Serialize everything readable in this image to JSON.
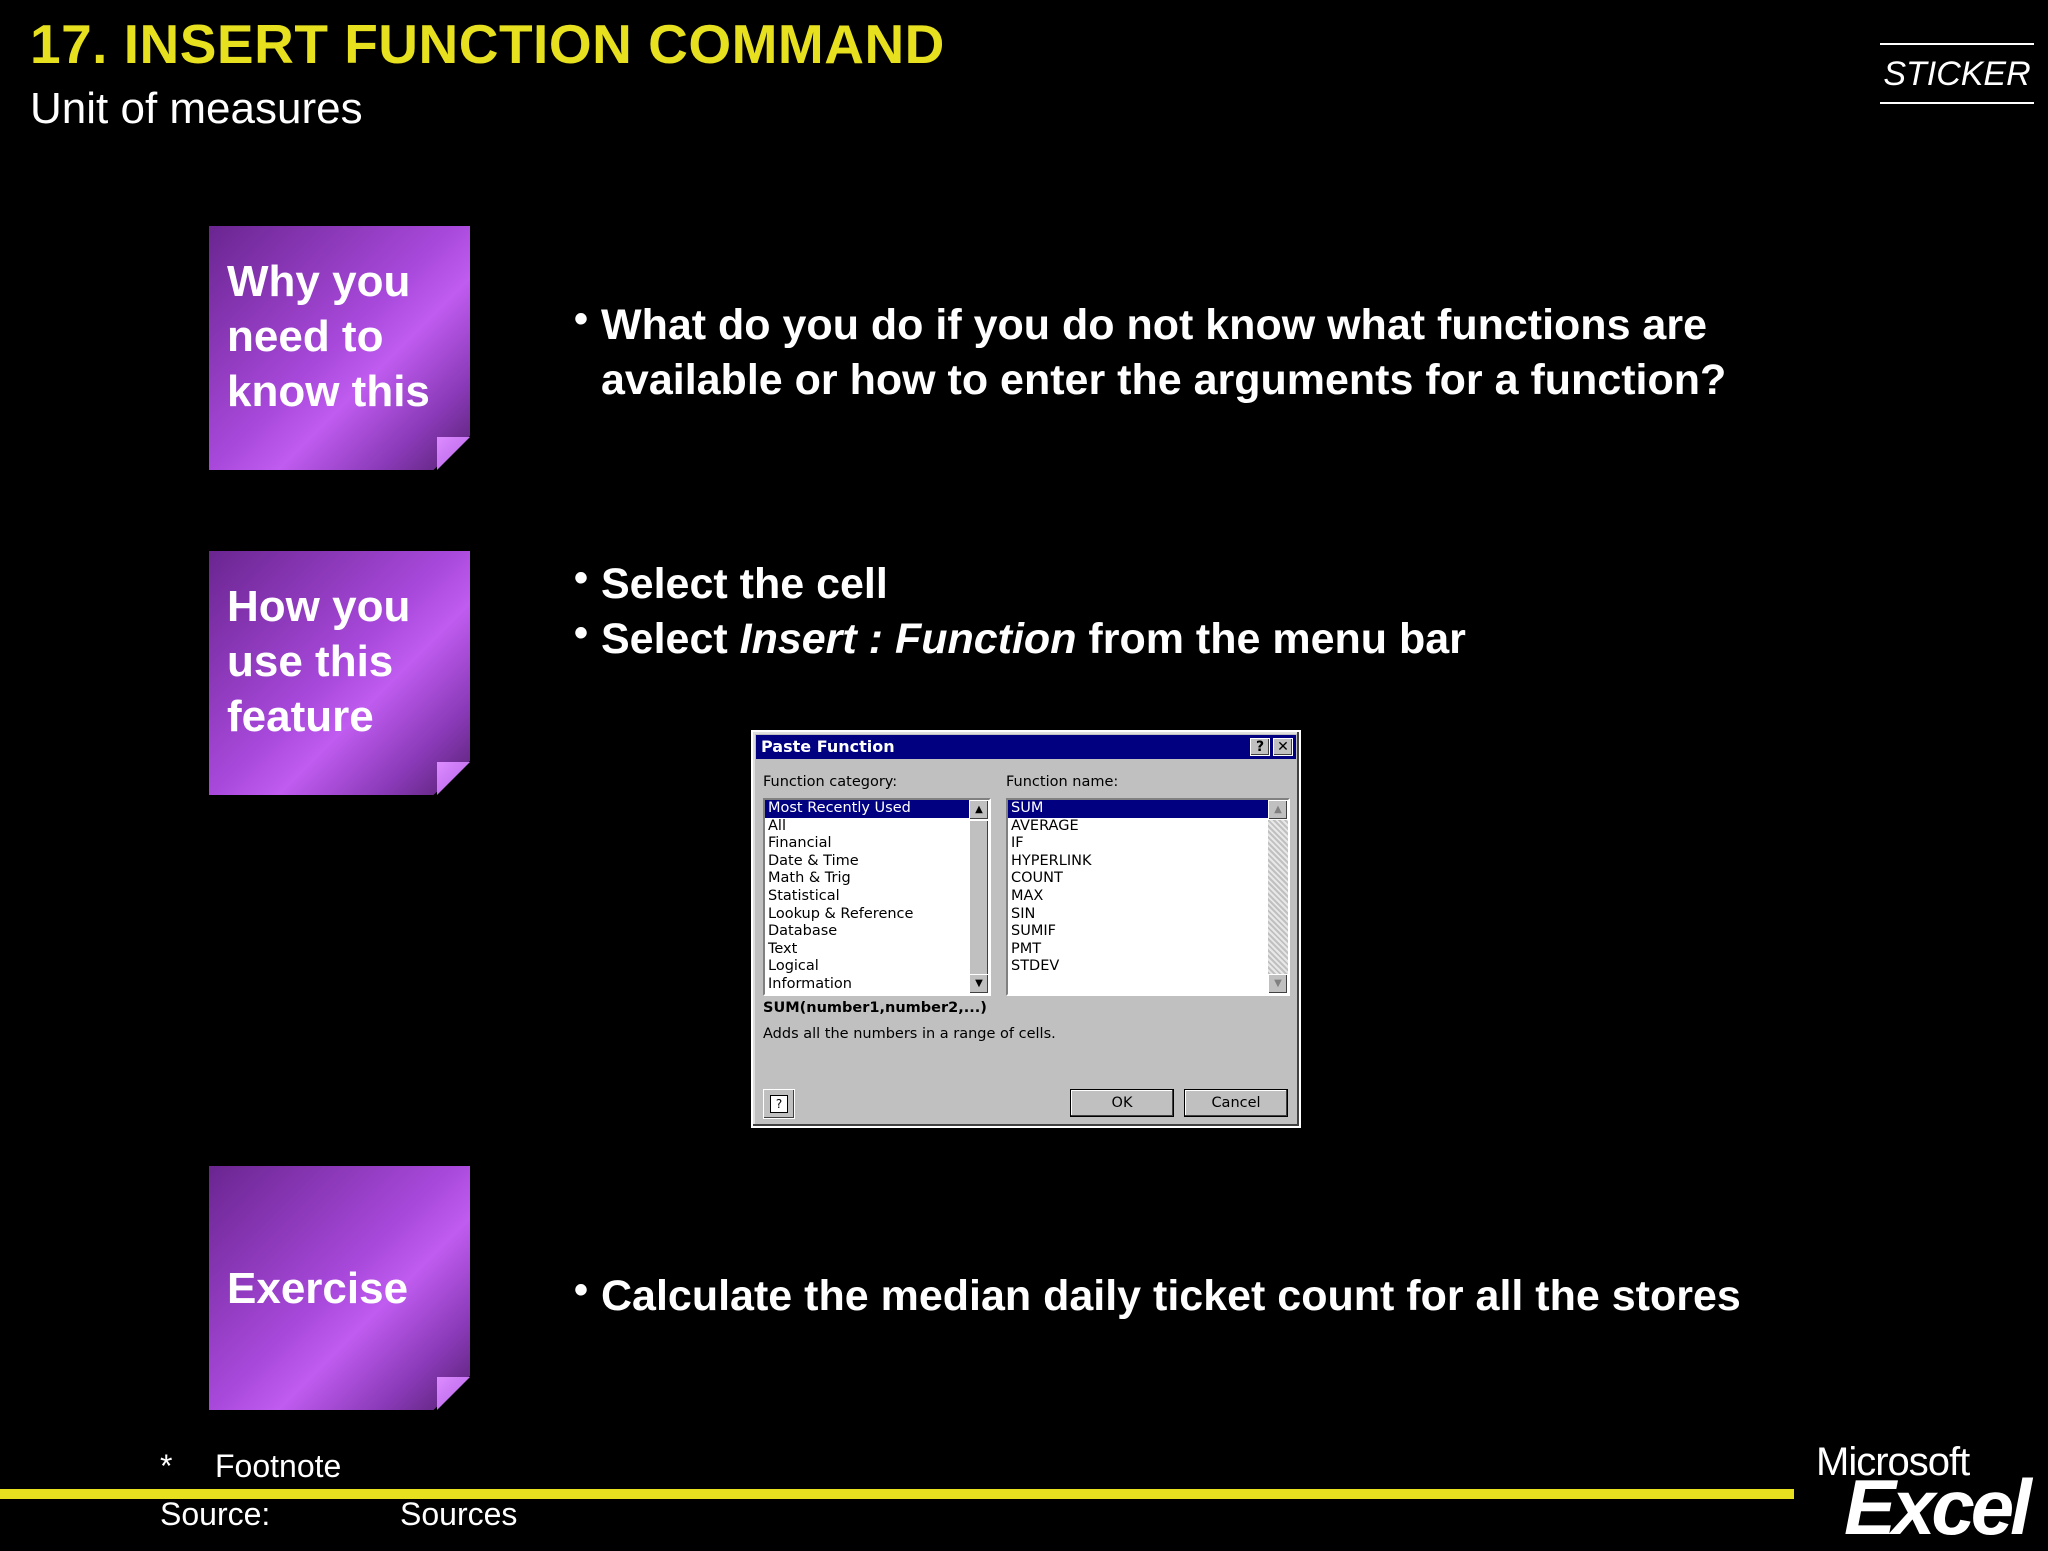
{
  "header": {
    "title": "17. INSERT FUNCTION COMMAND",
    "subtitle": "Unit of measures",
    "sticker": "STICKER"
  },
  "sections": {
    "why": {
      "label": "Why you need to know this",
      "bullets": [
        "What do you do if you do not know what functions are available or how to enter the arguments for a function?"
      ]
    },
    "how": {
      "label": "How you use this feature",
      "bullet1": "Select the cell",
      "bullet2_pre": "Select ",
      "bullet2_em": "Insert : Function",
      "bullet2_post": " from the menu bar"
    },
    "exercise": {
      "label": "Exercise",
      "bullets": [
        "Calculate the median daily ticket count for all the stores"
      ]
    }
  },
  "dialog": {
    "title": "Paste Function",
    "help_glyph": "?",
    "close_glyph": "✕",
    "category_label": "Function category:",
    "name_label": "Function name:",
    "categories": [
      "Most Recently Used",
      "All",
      "Financial",
      "Date & Time",
      "Math & Trig",
      "Statistical",
      "Lookup & Reference",
      "Database",
      "Text",
      "Logical",
      "Information"
    ],
    "selected_category": "Most Recently Used",
    "functions": [
      "SUM",
      "AVERAGE",
      "IF",
      "HYPERLINK",
      "COUNT",
      "MAX",
      "SIN",
      "SUMIF",
      "PMT",
      "STDEV"
    ],
    "selected_function": "SUM",
    "syntax": "SUM(number1,number2,...)",
    "description": "Adds all the numbers in a range of cells.",
    "ok_label": "OK",
    "cancel_label": "Cancel",
    "help_button_glyph": "?",
    "scroll_up": "▲",
    "scroll_down": "▼"
  },
  "footer": {
    "footnote_marker": "*",
    "footnote_text": "Footnote",
    "source_label": "Source:",
    "source_text": "Sources",
    "logo_top": "Microsoft",
    "logo_bottom": "Excel"
  },
  "colors": {
    "background": "#000000",
    "title_yellow": "#e6e01e",
    "box_purple": "#a748da",
    "dialog_titlebar": "#000080",
    "dialog_face": "#c0c0c0"
  }
}
